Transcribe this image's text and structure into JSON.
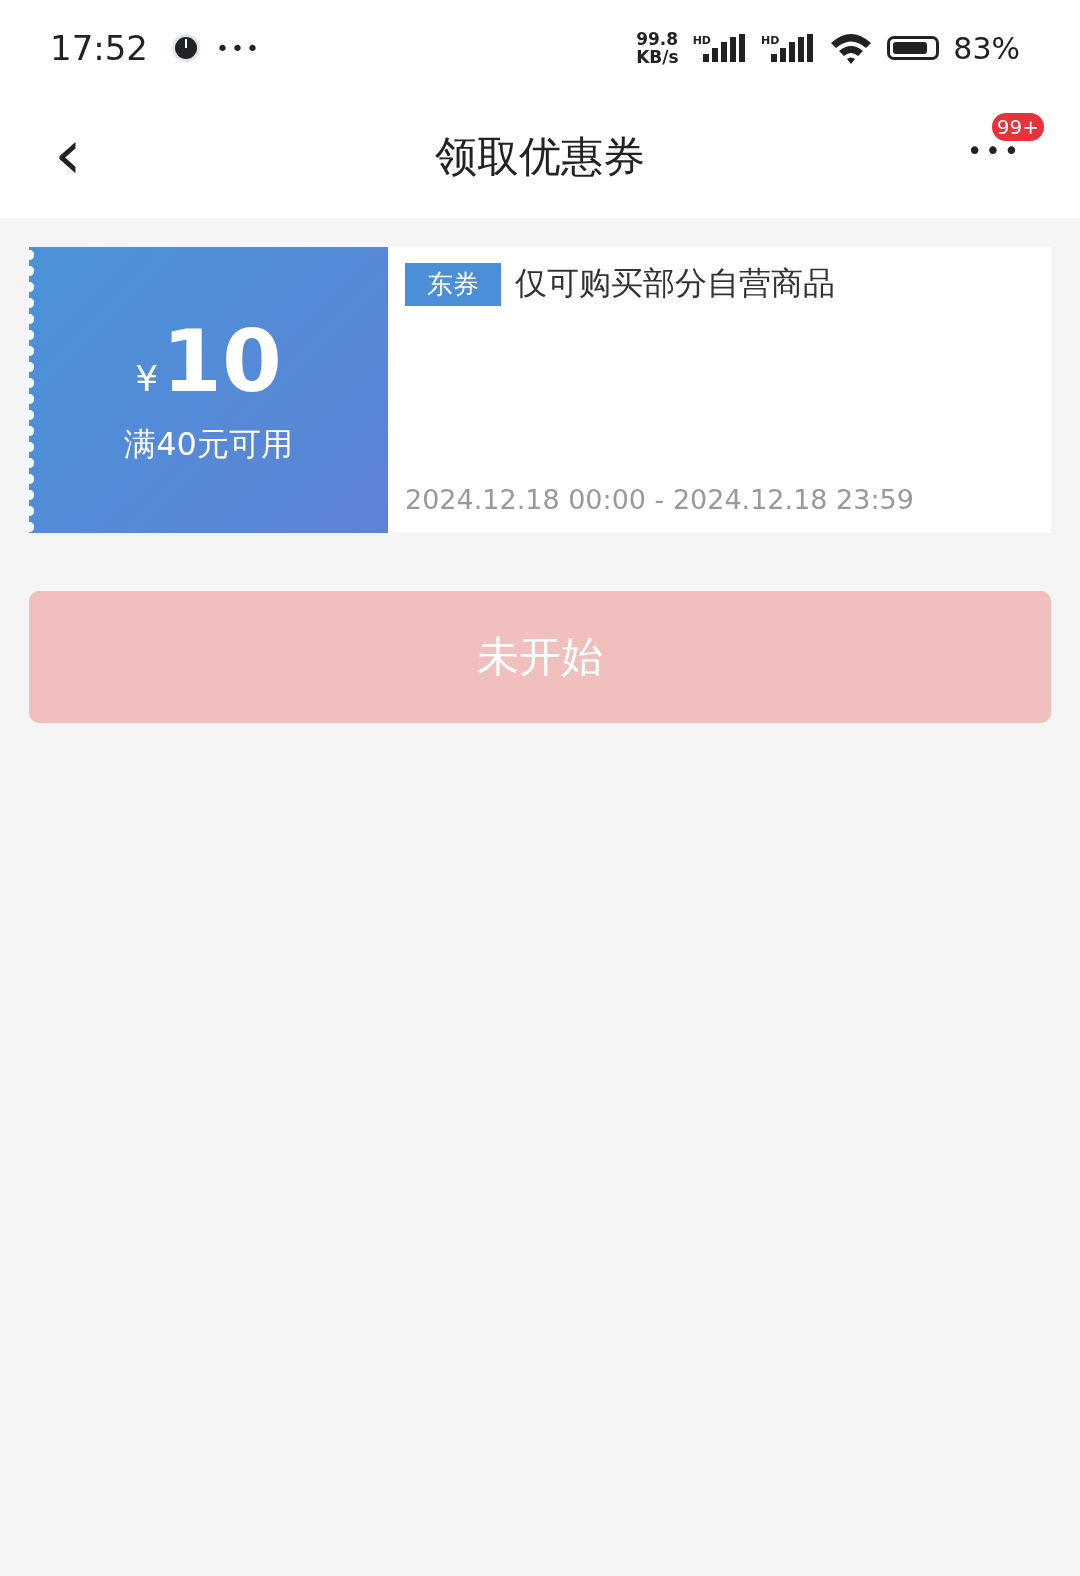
{
  "status_bar": {
    "time": "17:52",
    "more": "•••",
    "net_speed": {
      "value": "99.8",
      "unit": "KB/s"
    },
    "signals": [
      {
        "label": "HD"
      },
      {
        "label": "HD"
      }
    ],
    "battery": {
      "text": "83%"
    }
  },
  "header": {
    "back": "‹",
    "title": "领取优惠券",
    "more": "•••",
    "badge": "99+"
  },
  "coupon": {
    "currency": "¥",
    "amount": "10",
    "condition": "满40元可用",
    "tag": "东券",
    "description": "仅可购买部分自营商品",
    "validity": "2024.12.18 00:00 - 2024.12.18 23:59"
  },
  "action_button": {
    "label": "未开始",
    "disabled": true
  }
}
